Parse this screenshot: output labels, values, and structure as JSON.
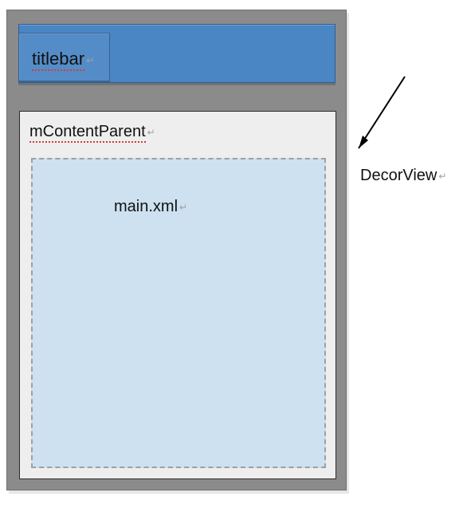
{
  "diagram": {
    "decorview_label": "DecorView",
    "titlebar_label": "titlebar",
    "content_parent_label": "mContentParent",
    "main_xml_label": "main.xml",
    "return_glyph": "↵"
  }
}
